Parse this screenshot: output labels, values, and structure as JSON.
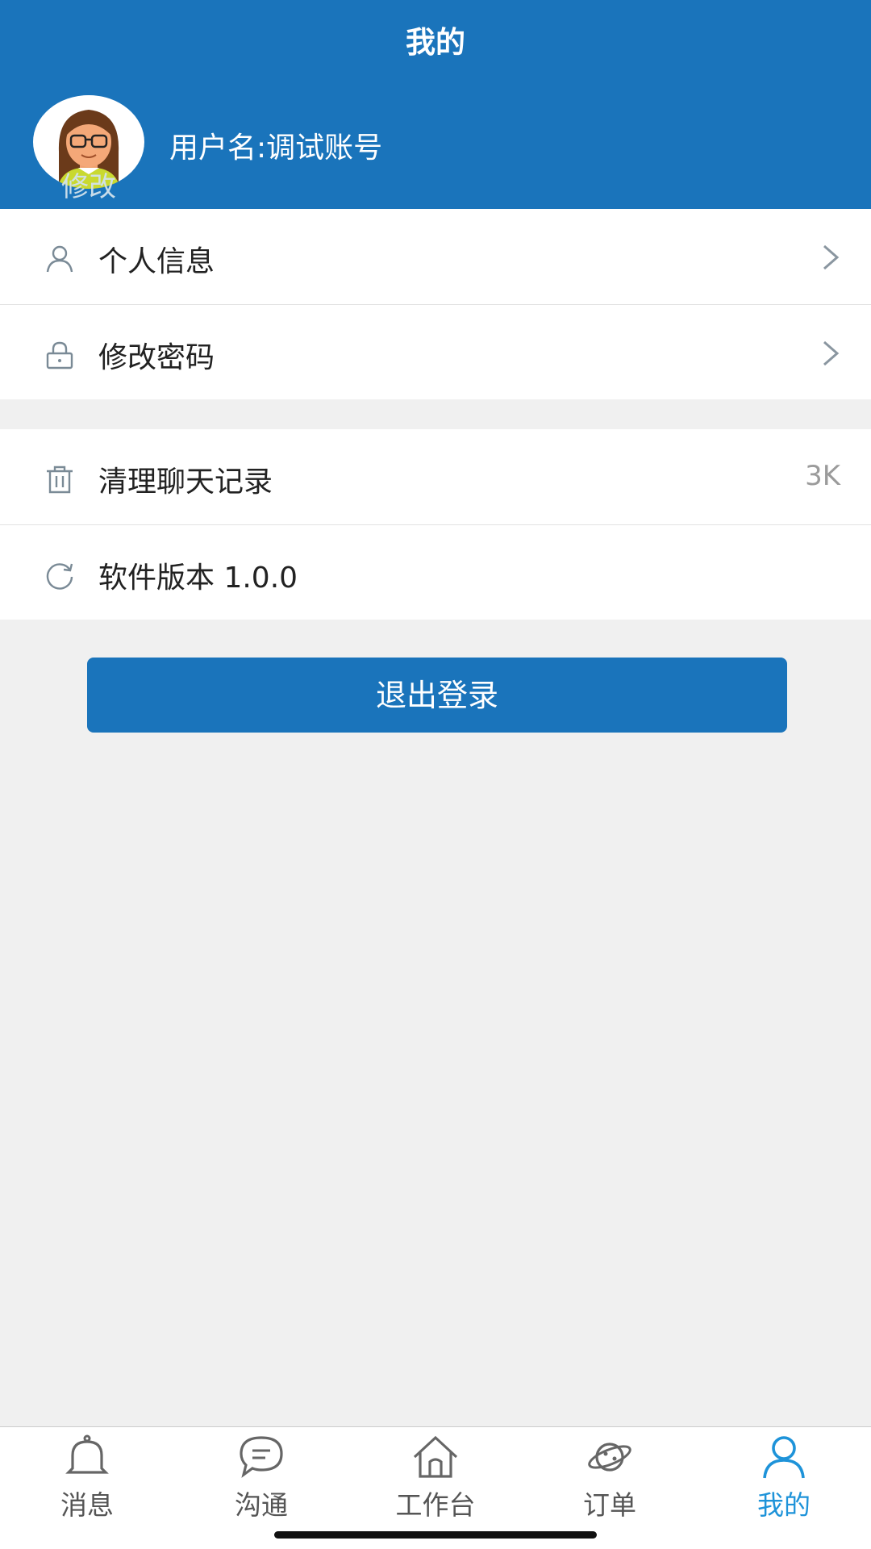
{
  "header": {
    "title": "我的",
    "avatar_edit_label": "修改",
    "username": "用户名:调试账号"
  },
  "menu_group_1": [
    {
      "icon": "user-icon",
      "label": "个人信息"
    },
    {
      "icon": "lock-icon",
      "label": "修改密码"
    }
  ],
  "menu_group_2": [
    {
      "icon": "trash-icon",
      "label": "清理聊天记录",
      "value": "3K"
    },
    {
      "icon": "refresh-icon",
      "label": "软件版本 1.0.0"
    }
  ],
  "logout_label": "退出登录",
  "tabs": [
    {
      "icon": "bell-icon",
      "label": "消息",
      "active": false
    },
    {
      "icon": "chat-bubble-icon",
      "label": "沟通",
      "active": false
    },
    {
      "icon": "home-icon",
      "label": "工作台",
      "active": false
    },
    {
      "icon": "planet-icon",
      "label": "订单",
      "active": false
    },
    {
      "icon": "user-icon",
      "label": "我的",
      "active": true
    }
  ],
  "colors": {
    "primary": "#1a74bb",
    "active_tab": "#1e93d9",
    "background": "#f0f0f0"
  }
}
